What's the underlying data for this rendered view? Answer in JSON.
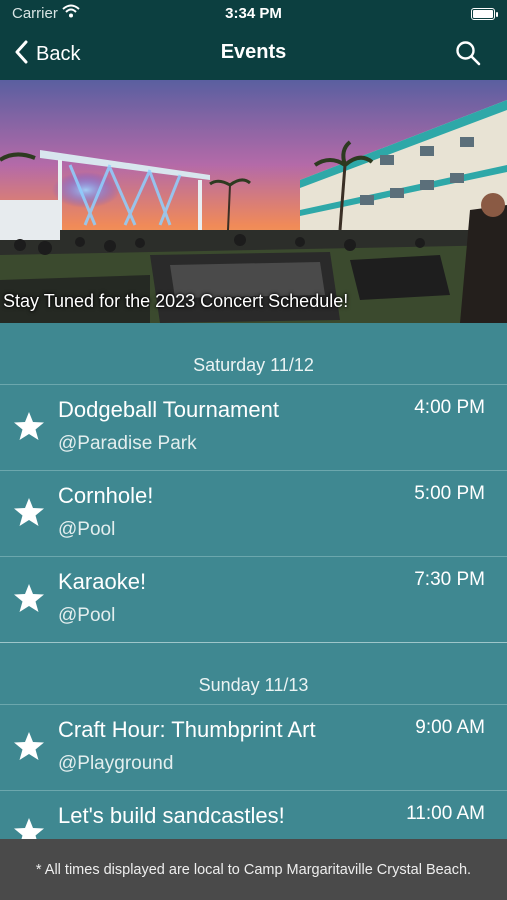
{
  "status_bar": {
    "carrier": "Carrier",
    "time": "3:34 PM"
  },
  "nav": {
    "back_label": "Back",
    "title": "Events"
  },
  "banner": {
    "caption": "Stay Tuned for the 2023 Concert Schedule!"
  },
  "days": [
    {
      "date": "Saturday 11/12",
      "events": [
        {
          "title": "Dodgeball Tournament",
          "location": "@Paradise Park",
          "time": "4:00 PM"
        },
        {
          "title": "Cornhole!",
          "location": "@Pool",
          "time": "5:00 PM"
        },
        {
          "title": "Karaoke!",
          "location": "@Pool",
          "time": "7:30 PM"
        }
      ]
    },
    {
      "date": "Sunday 11/13",
      "events": [
        {
          "title": "Craft Hour: Thumbprint Art",
          "location": "@Playground",
          "time": "9:00 AM"
        },
        {
          "title": "Let's build sandcastles!",
          "location": "",
          "time": "11:00 AM"
        }
      ]
    }
  ],
  "footer": {
    "note": "* All times displayed are local to Camp Margaritaville Crystal Beach."
  },
  "colors": {
    "nav_bg": "#0c3f40",
    "list_bg": "#3f8891",
    "footer_bg": "#4a4a4a"
  }
}
